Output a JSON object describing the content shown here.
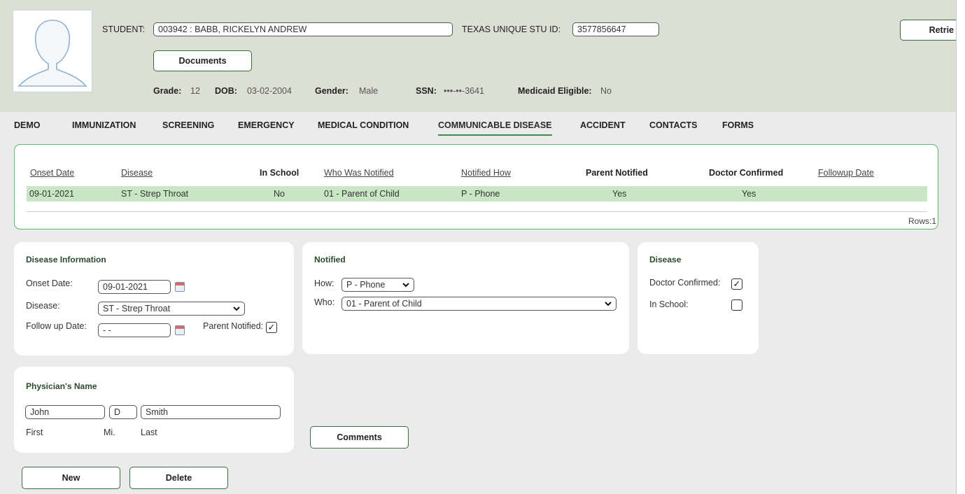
{
  "student": {
    "student_label": "STUDENT:",
    "student_value": "003942 : BABB, RICKELYN ANDREW",
    "texas_id_label": "TEXAS UNIQUE STU ID:",
    "texas_id_value": "3577856647",
    "retrieve_label": "Retrie",
    "documents_label": "Documents",
    "grade_label": "Grade:",
    "grade_value": "12",
    "dob_label": "DOB:",
    "dob_value": "03-02-2004",
    "gender_label": "Gender:",
    "gender_value": "Male",
    "ssn_label": "SSN:",
    "ssn_value": "•••-••-3641",
    "medicaid_label": "Medicaid Eligible:",
    "medicaid_value": "No"
  },
  "tabs": [
    {
      "label": "DEMO"
    },
    {
      "label": "IMMUNIZATION"
    },
    {
      "label": "SCREENING"
    },
    {
      "label": "EMERGENCY"
    },
    {
      "label": "MEDICAL CONDITION"
    },
    {
      "label": "COMMUNICABLE DISEASE",
      "active": true
    },
    {
      "label": "ACCIDENT"
    },
    {
      "label": "CONTACTS"
    },
    {
      "label": "FORMS"
    }
  ],
  "grid": {
    "columns": [
      "Onset Date",
      "Disease",
      "In School",
      "Who Was Notified",
      "Notified How",
      "Parent Notified",
      "Doctor Confirmed",
      "Followup Date"
    ],
    "rows": [
      [
        "09-01-2021",
        "ST - Strep Throat",
        "No",
        "01 - Parent of Child",
        "P - Phone",
        "Yes",
        "Yes",
        ""
      ]
    ],
    "rows_count": "Rows:1"
  },
  "disease_info": {
    "title": "Disease Information",
    "onset_label": "Onset Date:",
    "onset_value": "09-01-2021",
    "disease_label": "Disease:",
    "disease_value": "ST - Strep Throat",
    "followup_label": "Follow up Date:",
    "followup_value": "- -",
    "parent_notified_label": "Parent Notified:",
    "parent_notified_checked": true
  },
  "notified": {
    "title": "Notified",
    "how_label": "How:",
    "how_value": "P - Phone",
    "who_label": "Who:",
    "who_value": "01 - Parent of Child"
  },
  "disease_box": {
    "title": "Disease",
    "doctor_label": "Doctor Confirmed:",
    "doctor_checked": true,
    "in_school_label": "In School:",
    "in_school_checked": false
  },
  "physician": {
    "title": "Physician's Name",
    "first_value": "John",
    "mi_value": "D",
    "last_value": "Smith",
    "first_label": "First",
    "mi_label": "Mi.",
    "last_label": "Last"
  },
  "buttons": {
    "comments": "Comments",
    "new": "New",
    "delete": "Delete"
  },
  "icons": {
    "check_glyph": "✓",
    "calendar": "calendar-icon",
    "dropdown": "chevron-down-icon"
  }
}
